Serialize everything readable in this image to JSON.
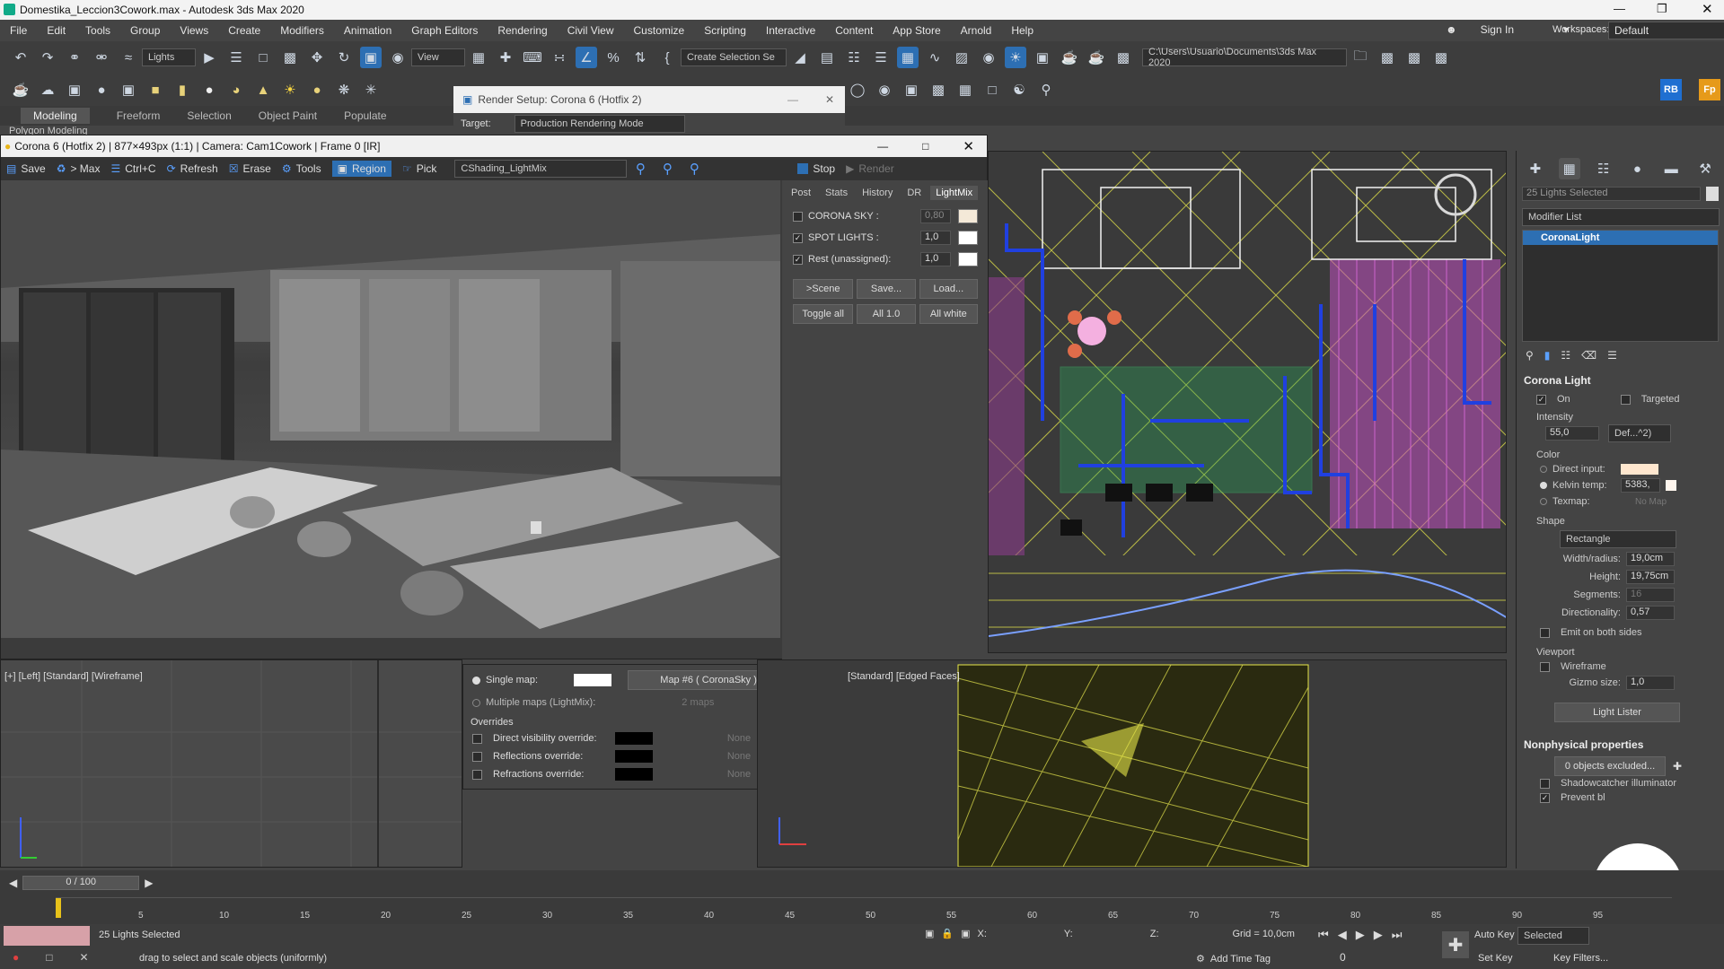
{
  "window": {
    "title": "Domestika_Leccion3Cowork.max - Autodesk 3ds Max 2020"
  },
  "menu": [
    "File",
    "Edit",
    "Tools",
    "Group",
    "Views",
    "Create",
    "Modifiers",
    "Animation",
    "Graph Editors",
    "Rendering",
    "Civil View",
    "Customize",
    "Scripting",
    "Interactive",
    "Content",
    "App Store",
    "Arnold",
    "Help"
  ],
  "account": {
    "sign_in": "Sign In",
    "workspaces_label": "Workspaces:",
    "workspace": "Default"
  },
  "toolbar": {
    "filter": "Lights",
    "ref_coord": "View",
    "selection_set": "Create Selection Se",
    "project_path": "C:\\Users\\Usuario\\Documents\\3ds Max 2020",
    "rb": "RB",
    "fp": "Fp"
  },
  "ribbon": {
    "tabs": [
      "Modeling",
      "Freeform",
      "Selection",
      "Object Paint",
      "Populate"
    ],
    "sub": "Polygon Modeling"
  },
  "render_setup": {
    "title": "Render Setup: Corona 6 (Hotfix 2)",
    "target_label": "Target:",
    "target_value": "Production Rendering Mode"
  },
  "vfb": {
    "title": "Corona 6 (Hotfix 2) | 877×493px (1:1) | Camera: Cam1Cowork | Frame 0 [IR]",
    "tools": [
      "Save",
      "> Max",
      "Ctrl+C",
      "Refresh",
      "Erase",
      "Tools",
      "Region",
      "Pick"
    ],
    "shading": "CShading_LightMix",
    "stop": "Stop",
    "render": "Render",
    "tabs": [
      "Post",
      "Stats",
      "History",
      "DR",
      "LightMix"
    ],
    "lights": [
      {
        "name": "CORONA SKY :",
        "value": "0,80",
        "checked": false,
        "color": "#f4e9d8"
      },
      {
        "name": "SPOT LIGHTS :",
        "value": "1,0",
        "checked": true,
        "color": "#ffffff"
      },
      {
        "name": "Rest (unassigned):",
        "value": "1,0",
        "checked": true,
        "color": "#ffffff"
      }
    ],
    "buttons1": [
      ">Scene",
      "Save...",
      "Load..."
    ],
    "buttons2": [
      "Toggle all",
      "All 1.0",
      "All white"
    ]
  },
  "env_panel": {
    "single_map": "Single map:",
    "map_name": "Map #6 ( CoronaSky )",
    "multiple_maps": "Multiple maps (LightMix):",
    "maps_count": "2 maps",
    "overrides": "Overrides",
    "rows": [
      "Direct visibility override:",
      "Reflections override:",
      "Refractions override:"
    ],
    "none": "None"
  },
  "viewports": {
    "left_label": "[+] [Left] [Standard] [Wireframe]",
    "persp_label": "[Standard] [Edged Faces]"
  },
  "cmd_panel": {
    "selected_count": "25 Lights Selected",
    "modifier_list": "Modifier List",
    "stack_item": "CoronaLight",
    "corona_light": "Corona Light",
    "on": "On",
    "targeted": "Targeted",
    "intensity_label": "Intensity",
    "intensity": "55,0",
    "intensity_unit": "Def...^2)",
    "color_label": "Color",
    "direct_input": "Direct input:",
    "kelvin": "Kelvin temp:",
    "kelvin_value": "5383,",
    "texmap": "Texmap:",
    "no_map": "No Map",
    "shape_label": "Shape",
    "shape": "Rectangle",
    "width_label": "Width/radius:",
    "width": "19,0cm",
    "height_label": "Height:",
    "height": "19,75cm",
    "segments_label": "Segments:",
    "segments": "16",
    "directionality_label": "Directionality:",
    "directionality": "0,57",
    "emit_both": "Emit on both sides",
    "viewport_label": "Viewport",
    "wireframe": "Wireframe",
    "gizmo_label": "Gizmo size:",
    "gizmo": "1,0",
    "light_lister": "Light Lister",
    "nonphysical": "Nonphysical properties",
    "excluded": "0 objects excluded...",
    "shadowcatcher": "Shadowcatcher illuminator",
    "prevent": "Prevent bl"
  },
  "timeline": {
    "frame": "0 / 100",
    "ticks": [
      "5",
      "10",
      "15",
      "20",
      "25",
      "30",
      "35",
      "40",
      "45",
      "50",
      "55",
      "60",
      "65",
      "70",
      "75",
      "80",
      "85",
      "90",
      "95"
    ]
  },
  "status": {
    "selected": "25 Lights Selected",
    "hint": "drag to select and scale objects (uniformly)",
    "x_label": "X:",
    "y_label": "Y:",
    "z_label": "Z:",
    "grid": "Grid = 10,0cm",
    "add_time_tag": "Add Time Tag",
    "auto_key": "Auto Key",
    "set_key": "Set Key",
    "selected_mode": "Selected",
    "key_filters": "Key Filters...",
    "frame_field": "0"
  },
  "colors": {
    "accent": "#2d6fb3",
    "cmd_bg": "#444444",
    "wire_yellow": "#d9d94a",
    "wire_magenta": "#c050c0",
    "wire_blue": "#2040e0"
  }
}
